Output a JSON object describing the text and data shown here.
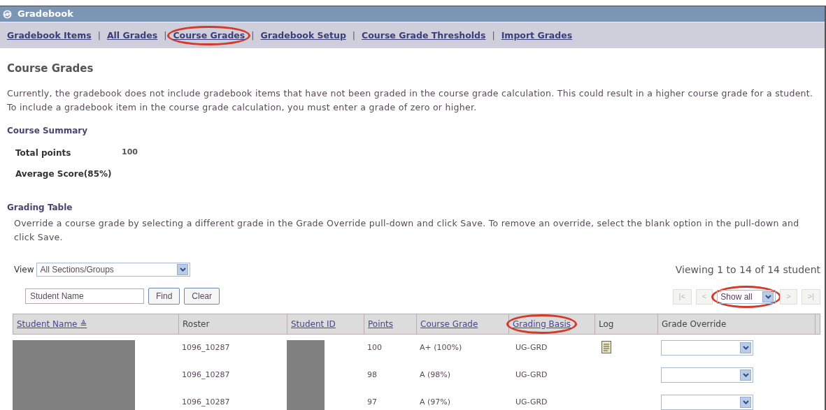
{
  "window": {
    "title": "Gradebook"
  },
  "nav": [
    {
      "label": "Gradebook Items",
      "circled": false
    },
    {
      "separator": "|",
      "label": "All Grades",
      "circled": false
    },
    {
      "separator": "|",
      "label": "Course Grades",
      "circled": true
    },
    {
      "separator": "|",
      "label": "Gradebook Setup",
      "circled": false
    },
    {
      "separator": "|",
      "label": "Course Grade Thresholds",
      "circled": false
    },
    {
      "separator": "|",
      "label": "Import Grades",
      "circled": false
    }
  ],
  "heading": "Course Grades",
  "intro": "Currently, the gradebook does not include gradebook items that have not been graded in the course grade calculation. This could result in a higher course grade for a student. To include a gradebook item in the course grade calculation, you must enter a grade of zero or higher.",
  "summary": {
    "title": "Course Summary",
    "rows": [
      {
        "label": "Total points",
        "value": "100"
      },
      {
        "label": "Average Score(85%)"
      }
    ]
  },
  "grading_table": {
    "title": "Grading Table",
    "instructions": "Override a course grade by selecting a different grade in the Grade Override pull-down and click Save. To remove an override, select the blank option in the pull-down and click Save.",
    "view_label": "View",
    "view_value": "All Sections/Groups",
    "search_value": "Student Name",
    "find": "Find",
    "clear": "Clear",
    "viewing": "Viewing 1 to 14 of 14 student",
    "pager": {
      "first": "|<",
      "prev": "<",
      "page_size": "Show all",
      "page_size_circled": true,
      "next": ">",
      "last": ">|"
    },
    "columns": [
      {
        "label": "Student Name ≜",
        "link": true,
        "circled": false
      },
      {
        "label": "Roster",
        "link": false,
        "circled": false
      },
      {
        "label": "Student ID",
        "link": true,
        "circled": false
      },
      {
        "label": "Points",
        "link": true,
        "circled": false
      },
      {
        "label": "Course Grade",
        "link": true,
        "circled": false
      },
      {
        "label": "Grading Basis",
        "link": true,
        "circled": true
      },
      {
        "label": "Log",
        "link": false,
        "circled": false
      },
      {
        "label": "Grade Override",
        "link": false,
        "circled": false
      }
    ],
    "rows": [
      {
        "roster": "1096_10287",
        "points": "100",
        "course_grade": "A+ (100%)",
        "grading_basis": "UG-GRD",
        "has_log": true
      },
      {
        "roster": "1096_10287",
        "points": "98",
        "course_grade": "A (98%)",
        "grading_basis": "UG-GRD",
        "has_log": false
      },
      {
        "roster": "1096_10287",
        "points": "97",
        "course_grade": "A (97%)",
        "grading_basis": "UG-GRD",
        "has_log": false
      }
    ]
  }
}
